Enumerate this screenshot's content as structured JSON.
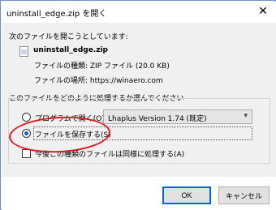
{
  "dialog": {
    "title": "uninstall_edge.zip を開く",
    "close_glyph": "✕"
  },
  "content": {
    "intro": "次のファイルを開こうとしています:",
    "file_name": "uninstall_edge.zip",
    "type_label": "ファイルの種類: ZIP ファイル (20.0 KB)",
    "location_label": "ファイルの場所: https://winaero.com",
    "question": "このファイルをどのように処理するか選んでください"
  },
  "options": {
    "open_with_label": "プログラムで開く(O):",
    "open_with_value": "Lhaplus Version 1.74 (既定)",
    "save_file_label": "ファイルを保存する(S)",
    "save_file_selected": true,
    "remember_label": "今後この種類のファイルは同様に処理する(A)",
    "remember_checked": false
  },
  "buttons": {
    "ok_label": "OK",
    "cancel_label": "キャンセル"
  },
  "colors": {
    "annotation": "#e0161f",
    "accent": "#0a64d8"
  },
  "icons": {
    "close": "close-icon",
    "file": "zip-file-icon",
    "dropdown": "chevron-down-icon"
  }
}
